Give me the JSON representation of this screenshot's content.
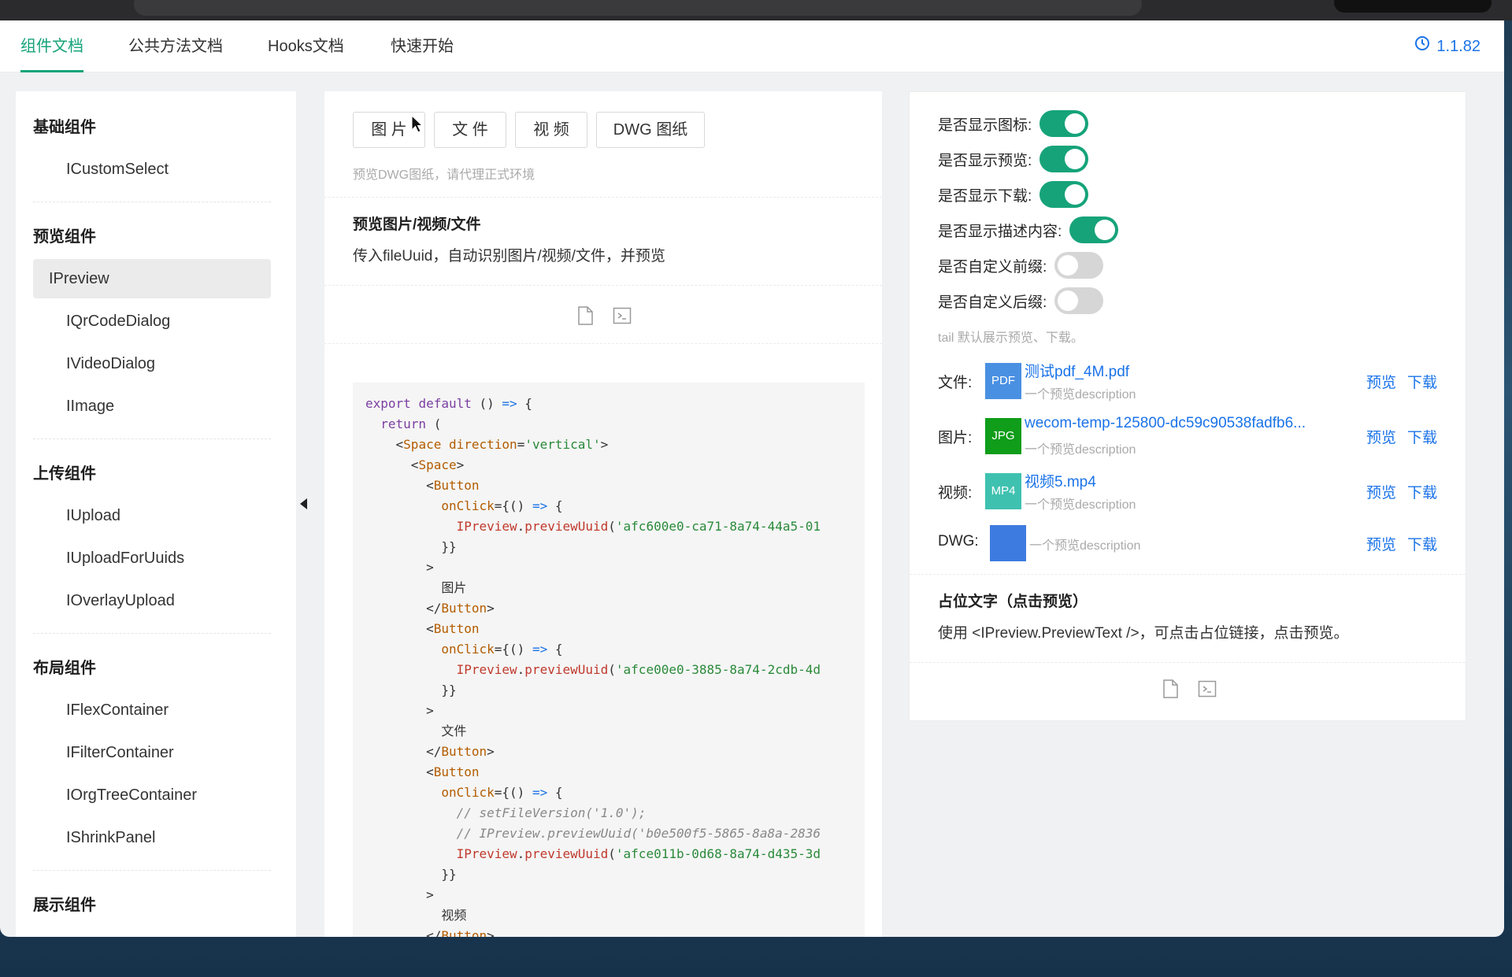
{
  "nav": {
    "tabs": [
      {
        "label": "组件文档",
        "active": true
      },
      {
        "label": "公共方法文档",
        "active": false
      },
      {
        "label": "Hooks文档",
        "active": false
      },
      {
        "label": "快速开始",
        "active": false
      }
    ],
    "version": "1.1.82"
  },
  "sidebar": {
    "groups": [
      {
        "title": "基础组件",
        "items": [
          "ICustomSelect"
        ]
      },
      {
        "title": "预览组件",
        "items": [
          "IPreview",
          "IQrCodeDialog",
          "IVideoDialog",
          "IImage"
        ]
      },
      {
        "title": "上传组件",
        "items": [
          "IUpload",
          "IUploadForUuids",
          "IOverlayUpload"
        ]
      },
      {
        "title": "布局组件",
        "items": [
          "IFlexContainer",
          "IFilterContainer",
          "IOrgTreeContainer",
          "IShrinkPanel"
        ]
      },
      {
        "title": "展示组件",
        "items": []
      }
    ],
    "active_item": "IPreview"
  },
  "left_demo": {
    "buttons": [
      "图 片",
      "文 件",
      "视 频",
      "DWG 图纸"
    ],
    "hint": "预览DWG图纸，请代理正式环境",
    "title": "预览图片/视频/文件",
    "description": "传入fileUuid，自动识别图片/视频/文件，并预览",
    "code_lines": [
      "export default () => {",
      "  return (",
      "    <Space direction='vertical'>",
      "      <Space>",
      "        <Button",
      "          onClick={() => {",
      "            IPreview.previewUuid('afc600e0-ca71-8a74-44a5-01",
      "          }}",
      "        >",
      "          图片",
      "        </Button>",
      "        <Button",
      "          onClick={() => {",
      "            IPreview.previewUuid('afce00e0-3885-8a74-2cdb-4d",
      "          }}",
      "        >",
      "          文件",
      "        </Button>",
      "        <Button",
      "          onClick={() => {",
      "            // setFileVersion('1.0');",
      "            // IPreview.previewUuid('b0e500f5-5865-8a8a-2836",
      "            IPreview.previewUuid('afce011b-0d68-8a74-d435-3d",
      "          }}",
      "        >",
      "          视频",
      "        </Button>"
    ]
  },
  "right_demo": {
    "toggles": [
      {
        "label": "是否显示图标:",
        "on": true
      },
      {
        "label": "是否显示预览:",
        "on": true
      },
      {
        "label": "是否显示下载:",
        "on": true
      },
      {
        "label": "是否显示描述内容:",
        "on": true
      },
      {
        "label": "是否自定义前缀:",
        "on": false
      },
      {
        "label": "是否自定义后缀:",
        "on": false
      }
    ],
    "tail_hint": "tail 默认展示预览、下载。",
    "files": [
      {
        "label": "文件:",
        "thumb": "PDF",
        "thumb_color": "#4a90e2",
        "name": "测试pdf_4M.pdf",
        "desc": "一个预览description"
      },
      {
        "label": "图片:",
        "thumb": "JPG",
        "thumb_color": "#0f9d1a",
        "name": "wecom-temp-125800-dc59c90538fadfb6...",
        "desc": "一个预览description"
      },
      {
        "label": "视频:",
        "thumb": "MP4",
        "thumb_color": "#3fc1b0",
        "name": "视频5.mp4",
        "desc": "一个预览description"
      },
      {
        "label": "DWG:",
        "thumb": "",
        "thumb_color": "#3d7be0",
        "name": "",
        "desc": "一个预览description"
      }
    ],
    "action_preview": "预览",
    "action_download": "下载",
    "placeholder_title": "占位文字（点击预览）",
    "placeholder_desc": "使用 <IPreview.PreviewText />，可点击占位链接，点击预览。"
  },
  "colors": {
    "accent": "#16a37a",
    "link": "#1a73e8"
  }
}
